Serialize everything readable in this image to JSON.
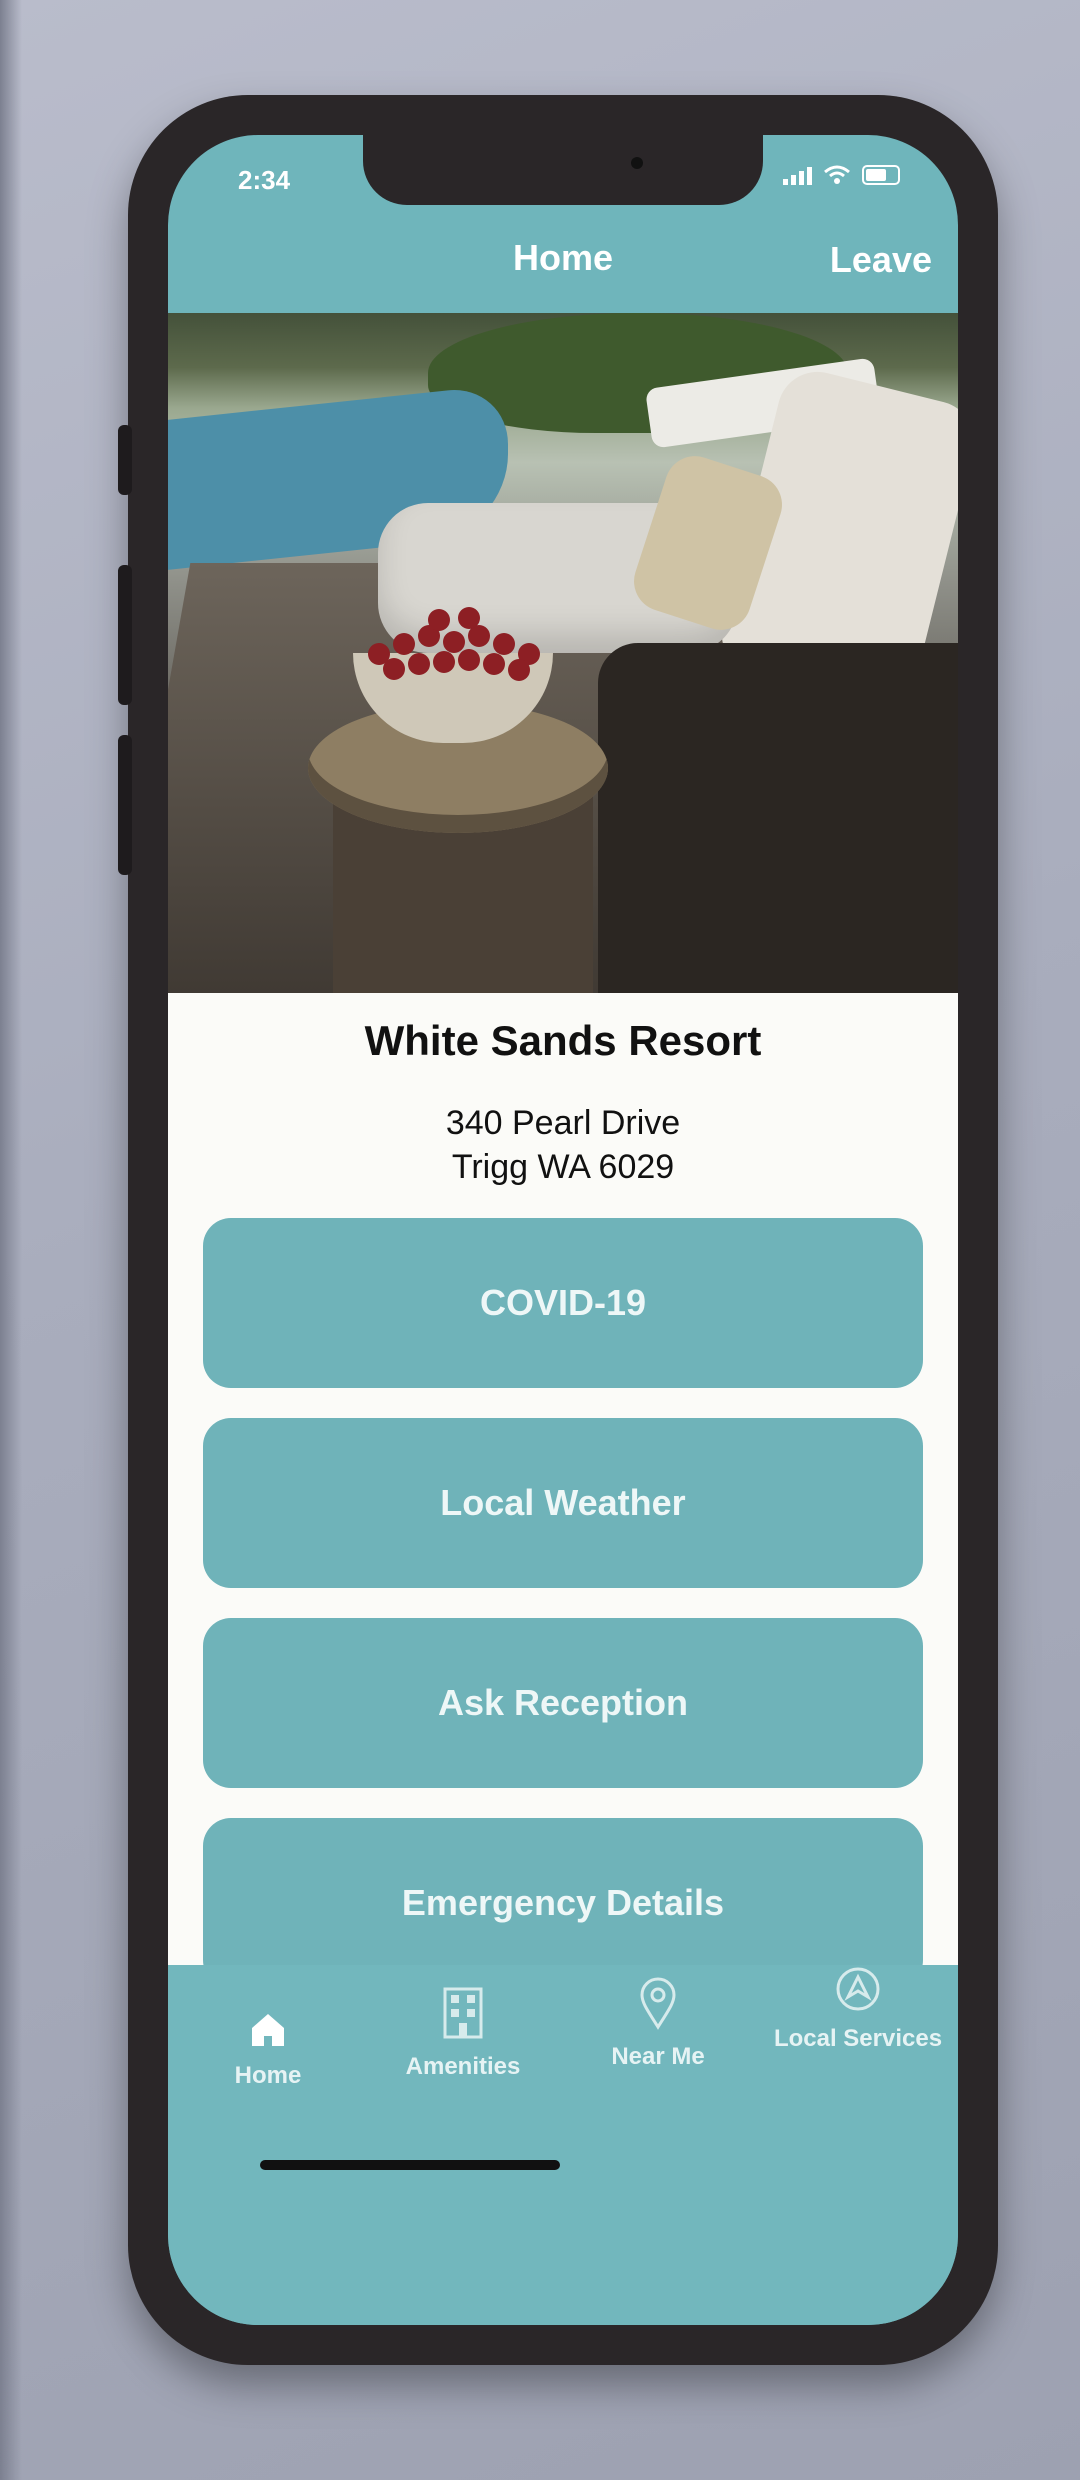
{
  "status_bar": {
    "time": "2:34"
  },
  "nav": {
    "title": "Home",
    "leave_label": "Leave"
  },
  "resort": {
    "name": "White Sands Resort",
    "address_line1": "340 Pearl Drive",
    "address_line2": "Trigg WA 6029"
  },
  "menu": [
    {
      "label": "COVID-19"
    },
    {
      "label": "Local Weather"
    },
    {
      "label": "Ask Reception"
    },
    {
      "label": "Emergency Details"
    }
  ],
  "tabs": [
    {
      "label": "Home",
      "icon": "home-icon"
    },
    {
      "label": "Amenities",
      "icon": "building-icon"
    },
    {
      "label": "Near Me",
      "icon": "map-pin-icon"
    },
    {
      "label": "Local Services",
      "icon": "compass-icon"
    }
  ],
  "colors": {
    "accent": "#6fb3b9",
    "content_bg": "#fbfbf8"
  }
}
